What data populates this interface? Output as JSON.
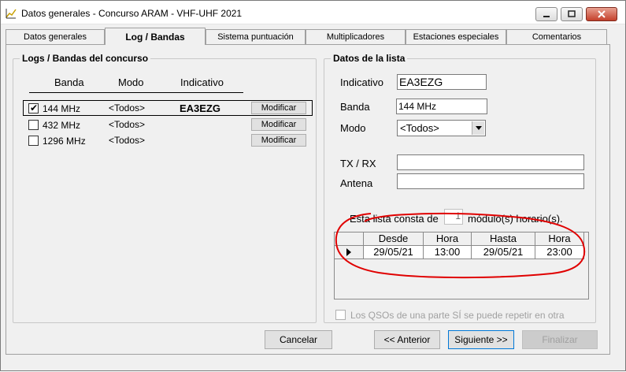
{
  "window": {
    "title": "Datos generales - Concurso ARAM - VHF-UHF 2021",
    "icon": "chart-icon"
  },
  "tabs": [
    {
      "label": "Datos generales"
    },
    {
      "label": "Log / Bandas"
    },
    {
      "label": "Sistema puntuación"
    },
    {
      "label": "Multiplicadores"
    },
    {
      "label": "Estaciones especiales"
    },
    {
      "label": "Comentarios"
    }
  ],
  "logs": {
    "title": "Logs / Bandas del concurso",
    "headers": {
      "banda": "Banda",
      "modo": "Modo",
      "indicativo": "Indicativo"
    },
    "rows": [
      {
        "band": "144 MHz",
        "mode": "<Todos>",
        "callsign": "EA3EZG",
        "checked": true,
        "button": "Modificar"
      },
      {
        "band": "432 MHz",
        "mode": "<Todos>",
        "callsign": "",
        "checked": false,
        "button": "Modificar"
      },
      {
        "band": "1296 MHz",
        "mode": "<Todos>",
        "callsign": "",
        "checked": false,
        "button": "Modificar"
      }
    ]
  },
  "details": {
    "title": "Datos de la lista",
    "indicativo_label": "Indicativo",
    "indicativo_value": "EA3EZG",
    "banda_label": "Banda",
    "banda_value": "144 MHz",
    "modo_label": "Modo",
    "modo_value": "<Todos>",
    "txrx_label": "TX / RX",
    "txrx_value": "",
    "antena_label": "Antena",
    "antena_value": "",
    "consta_prefix": "Esta lista consta de",
    "consta_count": "1",
    "consta_suffix": "módulo(s) horario(s).",
    "schedule": {
      "headers": [
        "Desde",
        "Hora",
        "Hasta",
        "Hora"
      ],
      "rows": [
        {
          "desde": "29/05/21",
          "hora1": "13:00",
          "hasta": "29/05/21",
          "hora2": "23:00"
        }
      ]
    },
    "qso_repeat_label": "Los QSOs de una parte SÍ se puede repetir en otra",
    "qso_repeat_checked": false
  },
  "footer": {
    "cancel": "Cancelar",
    "prev": "<< Anterior",
    "next": "Siguiente >>",
    "finish": "Finalizar"
  },
  "colors": {
    "annotation": "#e00000",
    "focus": "#0078d7"
  }
}
